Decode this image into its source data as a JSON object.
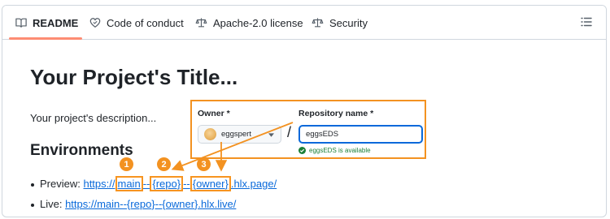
{
  "tabs": [
    {
      "label": "README",
      "icon": "book-icon",
      "active": true
    },
    {
      "label": "Code of conduct",
      "icon": "heart-icon",
      "active": false
    },
    {
      "label": "Apache-2.0 license",
      "icon": "law-icon",
      "active": false
    },
    {
      "label": "Security",
      "icon": "law-icon",
      "active": false
    }
  ],
  "outline_icon": "list-icon",
  "readme": {
    "title": "Your Project's Title...",
    "description": "Your project's description...",
    "environments_heading": "Environments",
    "preview": {
      "label": "Preview: ",
      "link_prefix": "https://",
      "part_main": "main",
      "sep1": "--",
      "part_repo": "{repo}",
      "sep2": "--",
      "part_owner": "{owner}",
      "link_suffix": ".hlx.page/"
    },
    "live": {
      "label": "Live: ",
      "link": "https://main--{repo}--{owner}.hlx.live/"
    }
  },
  "badges": [
    "1",
    "2",
    "3"
  ],
  "form": {
    "owner_label": "Owner *",
    "owner_value": "eggspert",
    "separator": "/",
    "repo_label": "Repository name *",
    "repo_value": "eggsEDS",
    "availability": "eggsEDS is available"
  },
  "colors": {
    "annotation": "#f39221",
    "link": "#0969da",
    "tab_underline": "#fd8c73",
    "available": "#1a7f37"
  }
}
